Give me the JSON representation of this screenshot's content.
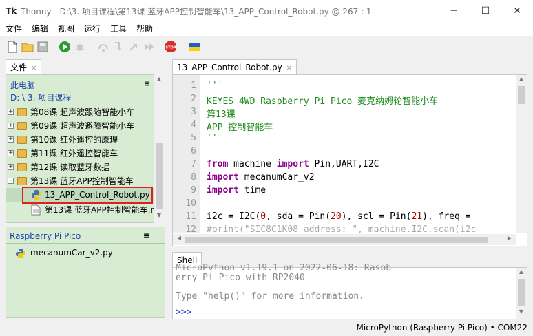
{
  "window": {
    "app_name": "Thonny",
    "path": "D:\\3. 项目课程\\第13课 蓝牙APP控制智能车\\13_APP_Control_Robot.py",
    "at": "@",
    "position": "267 : 1",
    "title_sep": "-"
  },
  "menu": [
    "文件",
    "编辑",
    "视图",
    "运行",
    "工具",
    "帮助"
  ],
  "toolbar": {
    "icons": [
      "new-file-icon",
      "open-folder-icon",
      "save-icon",
      "run-icon",
      "debug-icon",
      "step-over-icon",
      "step-into-icon",
      "step-out-icon",
      "resume-icon",
      "stop-icon",
      "ukraine-flag-icon"
    ],
    "stop_label": "STOP"
  },
  "files": {
    "tab_label": "文件",
    "this_pc": "此电脑",
    "current_path": "D: \\ 3. 项目课程",
    "items": [
      {
        "label": "第08课 超声波跟随智能小车",
        "expander": "+"
      },
      {
        "label": "第09课 超声波避障智能小车",
        "expander": "+"
      },
      {
        "label": "第10课 红外遥控的原理",
        "expander": "+"
      },
      {
        "label": "第11课 红外遥控智能车",
        "expander": "+"
      },
      {
        "label": "第12课 读取蓝牙数据",
        "expander": "+"
      },
      {
        "label": "第13课 蓝牙APP控制智能车",
        "expander": "-"
      }
    ],
    "children": [
      "13_APP_Control_Robot.py",
      "第13课 蓝牙APP控制智能车.m"
    ]
  },
  "pico": {
    "title": "Raspberry Pi Pico",
    "items": [
      "mecanumCar_v2.py"
    ]
  },
  "editor": {
    "tab_label": "13_APP_Control_Robot.py",
    "line_numbers": [
      "1",
      "2",
      "3",
      "4",
      "5",
      "6",
      "7",
      "8",
      "9",
      "10",
      "11",
      "12"
    ],
    "lines": {
      "l1": "'''",
      "l2": "KEYES 4WD Raspberry Pi Pico 麦克纳姆轮智能小车",
      "l3": "第13课",
      "l4": "APP 控制智能车",
      "l5": "'''",
      "l7a": "from",
      "l7b": " machine ",
      "l7c": "import",
      "l7d": " Pin,UART,I2C",
      "l8a": "import",
      "l8b": " mecanumCar_v2",
      "l9a": "import",
      "l9b": " time",
      "l11a": "i2c = I2C(",
      "l11b": "0",
      "l11c": ", sda = Pin(",
      "l11d": "20",
      "l11e": "), scl = Pin(",
      "l11f": "21",
      "l11g": "), freq =",
      "l12": "#print(\"SIC8C1K08 address: \", machine.I2C.scan(i2c"
    }
  },
  "shell": {
    "tab_label": "Shell",
    "partial_top": "MicroPython v1.19.1 on 2022-06-18; Raspb",
    "line1": "erry Pi Pico with RP2040",
    "line2": "Type \"help()\" for more information.",
    "prompt": ">>>"
  },
  "status": {
    "text": "MicroPython (Raspberry Pi Pico)  •  COM22"
  },
  "colors": {
    "files_bg": "#d7ecd3",
    "highlight_border": "#e02020",
    "string": "#1d8a1d",
    "keyword": "#8b008b",
    "number": "#a80000"
  }
}
